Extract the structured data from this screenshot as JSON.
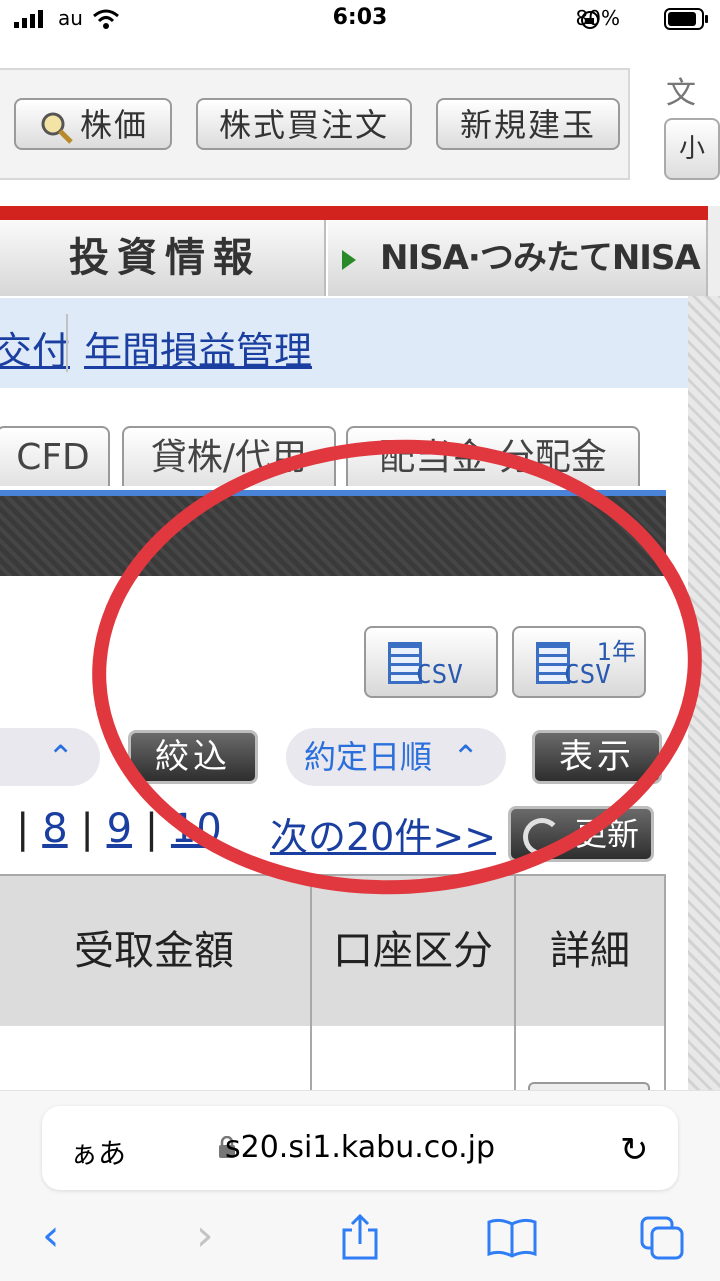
{
  "status_bar": {
    "carrier": "au",
    "time": "6:03",
    "battery": "80%"
  },
  "toolbar": {
    "buttons": [
      "株価",
      "株式買注文",
      "新規建玉"
    ],
    "font_size_label": "文字",
    "font_small": "小"
  },
  "nav": {
    "tab1": "投資情報",
    "tab2": "NISA·つみたてNISA"
  },
  "subnav": {
    "link1": "交付",
    "link2": "年間損益管理"
  },
  "tabs": [
    "CFD",
    "貸株/代用",
    "配当金·分配金"
  ],
  "csv": {
    "csv_label": "CSV",
    "year_label": "1年"
  },
  "filter": {
    "filter_button": "絞込",
    "sort_label": "約定日順",
    "display_button": "表示"
  },
  "pager": {
    "pages": [
      "8",
      "9",
      "10"
    ],
    "next_label": "次の20件>>",
    "refresh_label": "更新"
  },
  "table": {
    "headers": [
      "受取金額",
      "口座区分",
      "詳細"
    ]
  },
  "browser": {
    "aa": "ぁあ",
    "url": "s20.si1.kabu.co.jp"
  },
  "colors": {
    "accent_red": "#d2231f",
    "link_blue": "#1a3fa0",
    "annotation_red": "#e0383e"
  }
}
